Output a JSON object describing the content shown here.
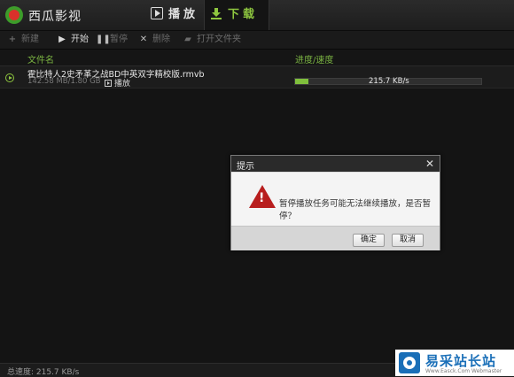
{
  "app": {
    "title": "西瓜影视"
  },
  "tabs": [
    {
      "label": "播放",
      "icon": "play-icon"
    },
    {
      "label": "下载",
      "icon": "download-icon"
    }
  ],
  "toolbar": {
    "new_label": "新建",
    "start_label": "开始",
    "pause_label": "暂停",
    "delete_label": "删除",
    "open_folder_label": "打开文件夹"
  },
  "columns": {
    "name": "文件名",
    "progress": "进度/速度"
  },
  "downloads": [
    {
      "name": "霍比特人2史矛革之战BD中英双字精校版.rmvb",
      "size": "142.58 MB/1.80 GB",
      "play_label": "播放",
      "progress": 0.07,
      "speed": "215.7 KB/s"
    }
  ],
  "dialog": {
    "title": "提示",
    "close_glyph": "✕",
    "message": "暂停播放任务可能无法继续播放，是否暂停？",
    "ok_label": "确定",
    "cancel_label": "取消"
  },
  "status": {
    "total_speed": "总速度: 215.7 KB/s"
  },
  "watermark": {
    "title": "易采站长站",
    "subtitle": "Www.Easck.Com Webmaster"
  },
  "colors": {
    "accent": "#8ec63f",
    "warning": "#b81e1e"
  }
}
